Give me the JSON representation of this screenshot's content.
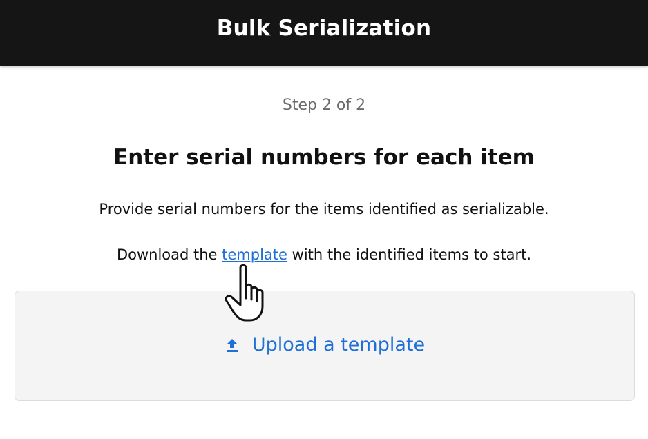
{
  "header": {
    "title": "Bulk Serialization"
  },
  "step": {
    "label": "Step 2 of 2"
  },
  "main": {
    "heading": "Enter serial numbers for each item",
    "description": "Provide serial numbers for the items identified as serializable.",
    "download_prefix": "Download the ",
    "download_link": "template",
    "download_suffix": " with the identified items to start."
  },
  "upload": {
    "label": "Upload a template",
    "icon": "upload-icon"
  },
  "colors": {
    "header_bg": "#151515",
    "link": "#1f6fd6",
    "panel_bg": "#f4f4f4"
  }
}
